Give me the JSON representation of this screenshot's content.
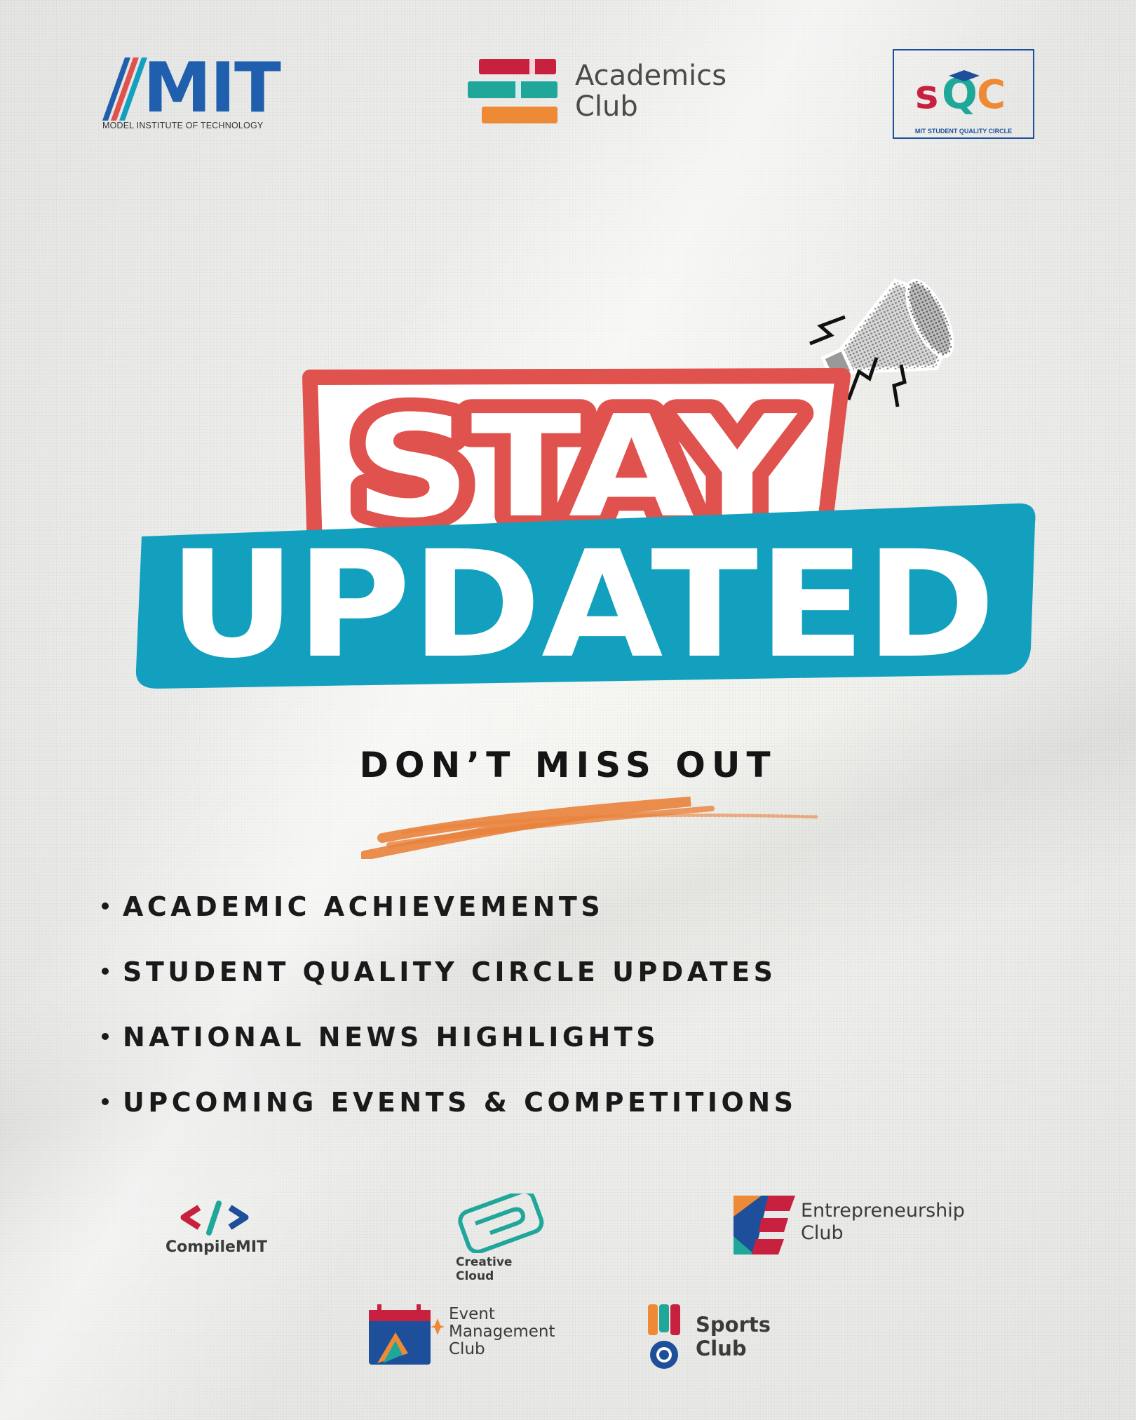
{
  "header": {
    "mit": {
      "wordmark": "MIT",
      "subtitle": "MODEL INSTITUTE OF TECHNOLOGY"
    },
    "academics_club": {
      "line1": "Academics",
      "line2": "Club"
    },
    "sqc": {
      "letters": [
        "s",
        "Q",
        "C"
      ],
      "subtitle": "MIT STUDENT QUALITY CIRCLE"
    }
  },
  "headline": {
    "line1": "STAY",
    "line2": "UPDATED"
  },
  "subtitle": "DON’T MISS OUT",
  "bullets": [
    "ACADEMIC ACHIEVEMENTS",
    "STUDENT QUALITY CIRCLE UPDATES",
    "NATIONAL NEWS HIGHLIGHTS",
    "UPCOMING EVENTS & COMPETITIONS"
  ],
  "clubs": {
    "compile": {
      "name": "CompileMIT"
    },
    "creative": {
      "name": "Creative Cloud"
    },
    "entrepreneurship": {
      "line1": "Entrepreneurship",
      "line2": "Club"
    },
    "event": {
      "line1": "Event",
      "line2": "Management",
      "line3": "Club"
    },
    "sports": {
      "line1": "Sports",
      "line2": "Club"
    }
  },
  "colors": {
    "red": "#e0524d",
    "teal": "#12a0be",
    "orange": "#e9823b",
    "blue": "#1f5fad",
    "text": "#151515"
  },
  "icons": [
    "megaphone-icon",
    "code-brackets-icon",
    "creative-cloud-icon",
    "entrepreneurship-e-icon",
    "event-calendar-icon",
    "medal-icon",
    "books-icon"
  ]
}
